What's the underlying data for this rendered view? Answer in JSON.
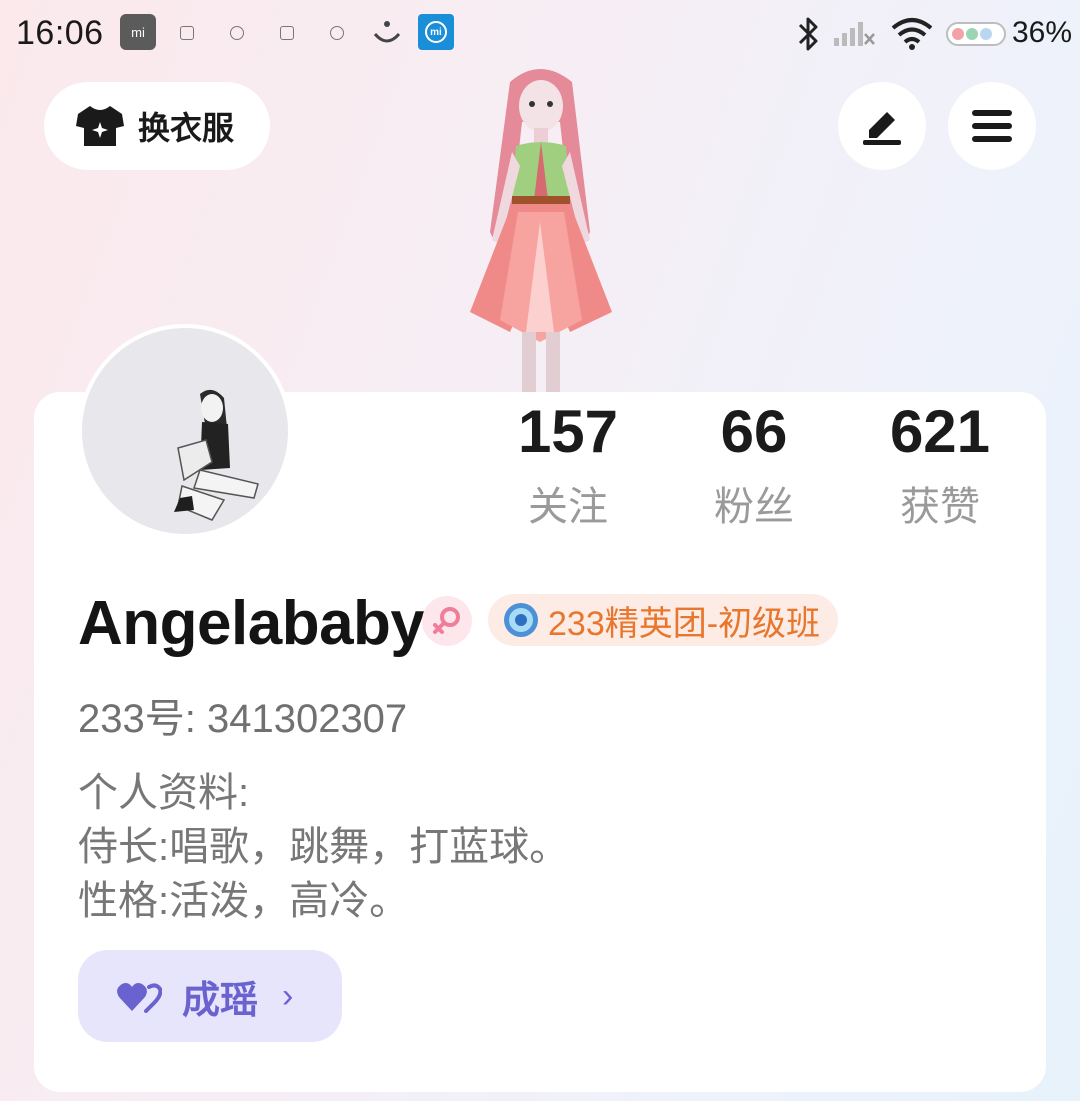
{
  "status_bar": {
    "time": "16:06",
    "battery_percent": "36%",
    "icons": [
      "mi-icon",
      "gallery-icon",
      "message-icon",
      "image-icon",
      "chat-icon",
      "download-icon",
      "mi-app-icon",
      "bluetooth-icon",
      "signal-icon",
      "wifi-icon",
      "battery-icon"
    ]
  },
  "top_bar": {
    "outfit_label": "换衣服",
    "outfit_icon": "tshirt-icon",
    "edit_icon": "edit-icon",
    "menu_icon": "menu-icon"
  },
  "stats": [
    {
      "value": "157",
      "label": "关注"
    },
    {
      "value": "66",
      "label": "粉丝"
    },
    {
      "value": "621",
      "label": "获赞"
    }
  ],
  "profile": {
    "name": "Angelababy",
    "gender_icon": "female-icon",
    "badge_text": "233精英团-初级班",
    "badge_icon": "medal-icon",
    "uid_line": "233号: 341302307",
    "bio_lines": [
      "个人资料:",
      "侍长:唱歌，跳舞，打蓝球。",
      "性格:活泼，高冷。"
    ]
  },
  "partner_button": {
    "label": "成瑶",
    "icon": "heart-pair-icon",
    "chevron": "›"
  },
  "colors": {
    "badge_text": "#e8772d",
    "partner_text": "#6a62cf",
    "partner_bg": "#e7e5fb"
  }
}
